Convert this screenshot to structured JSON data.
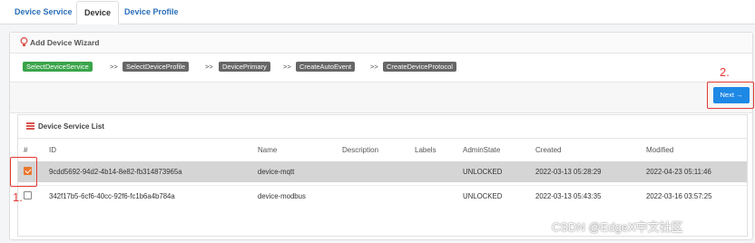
{
  "tabs": {
    "device_service": "Device Service",
    "device": "Device",
    "device_profile": "Device Profile"
  },
  "wizard": {
    "title": "Add Device Wizard",
    "steps": [
      "SelectDeviceService",
      "SelectDeviceProfile",
      "DevicePrimary",
      "CreateAutoEvent",
      "CreateDeviceProtocol"
    ],
    "separator": ">>",
    "next_label": "Next →"
  },
  "annotations": {
    "one": "1.",
    "two": "2."
  },
  "list": {
    "title": "Device Service List",
    "columns": [
      "#",
      "ID",
      "Name",
      "Description",
      "Labels",
      "AdminState",
      "Created",
      "Modified"
    ],
    "rows": [
      {
        "id": "9cdd5692-94d2-4b14-8e82-fb314873965a",
        "name": "device-mqtt",
        "description": "",
        "labels": "",
        "admin_state": "UNLOCKED",
        "created": "2022-03-13 05:28:29",
        "modified": "2022-04-23 05:11:46",
        "checked": true
      },
      {
        "id": "342f17b5-6cf6-40cc-92f6-fc1b6a4b784a",
        "name": "device-modbus",
        "description": "",
        "labels": "",
        "admin_state": "UNLOCKED",
        "created": "2022-03-13 05:43:35",
        "modified": "2022-03-16 03:57:25",
        "checked": false
      }
    ]
  },
  "watermark": "CSDN @EdgeX中文社区",
  "colors": {
    "accent": "#1e88e5",
    "step_active": "#3aa44a",
    "annotation": "#e53935",
    "checkbox": "#e8772e"
  }
}
